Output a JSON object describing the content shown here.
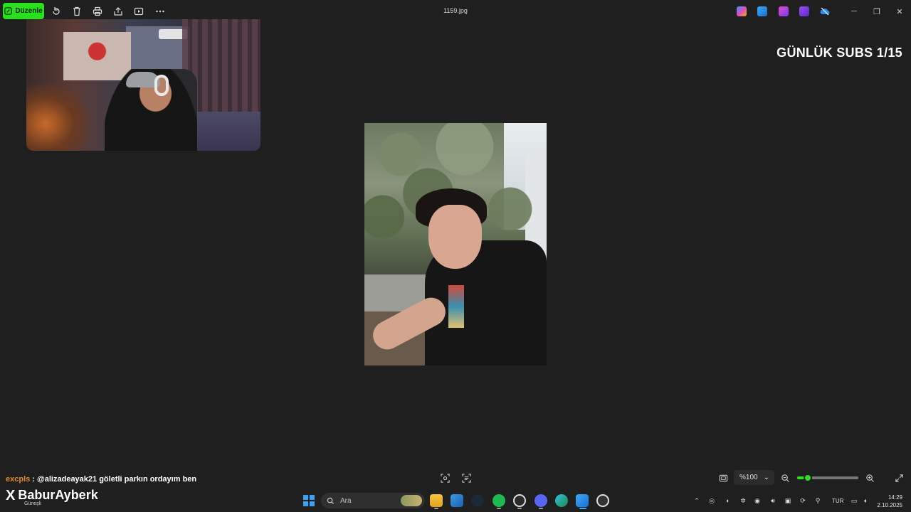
{
  "toolbar": {
    "edit_label": "Düzenle",
    "icons": [
      "rotate-icon",
      "delete-icon",
      "print-icon",
      "share-icon",
      "slideshow-icon",
      "more-icon"
    ],
    "file_name": "1159.jpg",
    "app_icons": [
      "copilot-icon",
      "photos-icon",
      "designer-icon",
      "clipchamp-icon",
      "onedrive-icon"
    ],
    "window_controls": {
      "minimize": "─",
      "maximize": "❐",
      "close": "✕"
    }
  },
  "overlay": {
    "subs_counter": "GÜNLÜK SUBS 1/15"
  },
  "chat": {
    "username": "excpls",
    "separator": " : ",
    "message": "@alizadeayak21 göletli parkın ordayım ben"
  },
  "brand": {
    "logo_glyph": "X",
    "name": "BaburAyberk",
    "subtitle": "Güneşli"
  },
  "viewer_bar": {
    "zoom_value": "%100",
    "zoom_chevron": "⌄",
    "zoom_level": 0.18
  },
  "taskbar": {
    "search_placeholder": "Ara",
    "apps": [
      "file-explorer",
      "photos-gallery",
      "steam",
      "spotify",
      "obs",
      "discord",
      "edge",
      "photos",
      "media-player"
    ],
    "language": "TUR",
    "time": "14:29",
    "date": "2.10.2025"
  },
  "colors": {
    "accent": "#28e01c",
    "background": "#1f1f1f",
    "chat_user": "#e2892a"
  }
}
